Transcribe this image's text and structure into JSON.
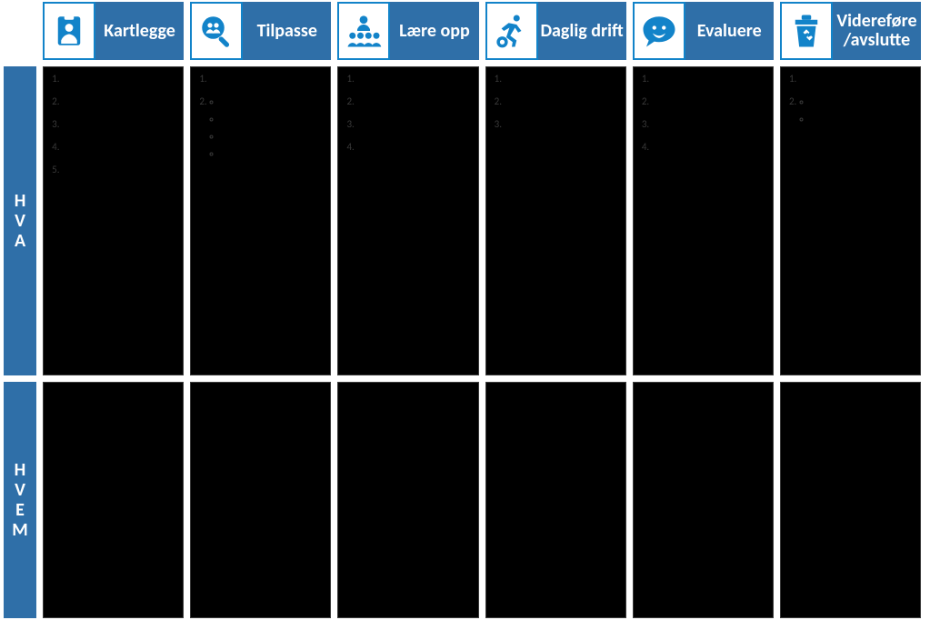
{
  "rows": {
    "r1": "HVA",
    "r2": "HVEM"
  },
  "columns": [
    {
      "id": "kartlegge",
      "label": "Kartlegge",
      "icon": "badge-icon"
    },
    {
      "id": "tilpasse",
      "label": "Tilpasse",
      "icon": "magnify-people-icon"
    },
    {
      "id": "laereopp",
      "label": "Lære opp",
      "icon": "team-icon"
    },
    {
      "id": "dagligdrift",
      "label": "Daglig drift",
      "icon": "running-gear-icon"
    },
    {
      "id": "evaluere",
      "label": "Evaluere",
      "icon": "smiley-chat-icon"
    },
    {
      "id": "viderefore",
      "label": "Videreføre /avslutte",
      "icon": "trash-icon"
    }
  ],
  "hva": {
    "kartlegge": {
      "type": "ol",
      "items": [
        "",
        "",
        "",
        "",
        ""
      ]
    },
    "tilpasse": {
      "type": "ol",
      "items": [
        "",
        {
          "text": "",
          "sub": [
            "",
            "",
            "",
            ""
          ]
        }
      ]
    },
    "laereopp": {
      "type": "ol",
      "items": [
        "",
        "",
        "",
        ""
      ]
    },
    "dagligdrift": {
      "type": "ol",
      "items": [
        "",
        "",
        ""
      ]
    },
    "evaluere": {
      "type": "ol",
      "items": [
        "",
        "",
        "",
        ""
      ]
    },
    "viderefore": {
      "type": "ol",
      "items": [
        "",
        {
          "text": "",
          "sub": [
            "",
            ""
          ]
        }
      ]
    }
  },
  "hvem": {
    "kartlegge": {
      "type": "plain",
      "text": ""
    },
    "tilpasse": {
      "type": "plain",
      "text": ""
    },
    "laereopp": {
      "type": "plain",
      "text": ""
    },
    "dagligdrift": {
      "type": "plain",
      "text": ""
    },
    "evaluere": {
      "type": "plain",
      "text": ""
    },
    "viderefore": {
      "type": "plain",
      "text": ""
    }
  }
}
